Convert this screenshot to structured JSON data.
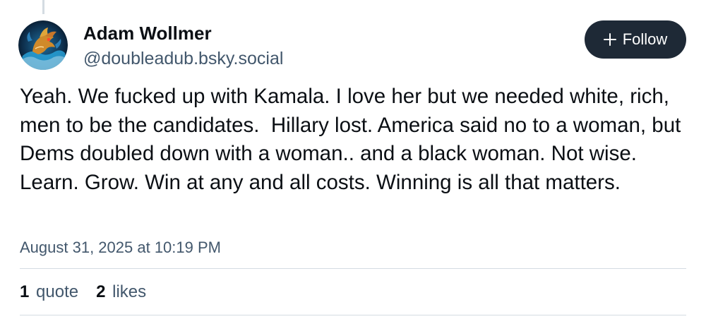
{
  "author": {
    "name": "Adam Wollmer",
    "handle": "@doubleadub.bsky.social",
    "avatar": "dragon-avatar-icon"
  },
  "follow_button": {
    "icon": "plus-icon",
    "label": "Follow"
  },
  "post": {
    "text": "Yeah. We fucked up with Kamala. I love her but we needed white, rich, men to be the candidates.  Hillary lost. America said no to a woman, but Dems doubled down with a woman.. and a black woman. Not wise. Learn. Grow. Win at any and all costs. Winning is all that matters.",
    "timestamp": "August 31, 2025 at 10:19 PM"
  },
  "stats": {
    "quotes": {
      "count": "1",
      "label": "quote"
    },
    "likes": {
      "count": "2",
      "label": "likes"
    }
  },
  "colors": {
    "text": "#0b0f14",
    "secondary": "#42576c",
    "button_bg": "#1e2936",
    "divider": "#d4dbe2"
  }
}
